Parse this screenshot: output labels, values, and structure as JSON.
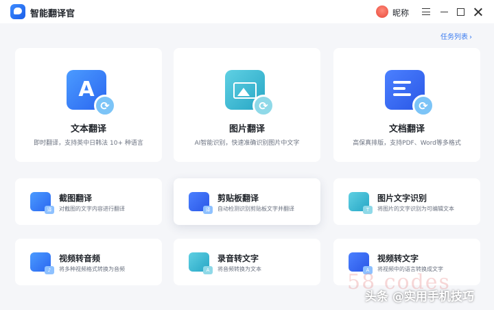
{
  "titlebar": {
    "app_title": "智能翻译官",
    "user_name": "昵称",
    "icons": [
      "app-logo-icon",
      "avatar",
      "menu-icon",
      "minimize-icon",
      "maximize-icon",
      "close-icon"
    ]
  },
  "task_list": {
    "label": "任务列表",
    "chevron": "›"
  },
  "big_cards": [
    {
      "title": "文本翻译",
      "desc": "即时翻译，支持英中日韩法 10+ 种语言",
      "icon": "text-translate-icon"
    },
    {
      "title": "图片翻译",
      "desc": "AI智能识别，快速准确识别图片中文字",
      "icon": "image-translate-icon"
    },
    {
      "title": "文档翻译",
      "desc": "高保真排版，支持PDF、Word等多格式",
      "icon": "document-translate-icon"
    }
  ],
  "small_cards": [
    {
      "title": "截图翻译",
      "desc": "对截图的文字内容进行翻译",
      "icon": "screenshot-icon",
      "badge": "译"
    },
    {
      "title": "剪贴板翻译",
      "desc": "自动检测识别剪贴板文字并翻译",
      "icon": "clipboard-icon",
      "badge": "译"
    },
    {
      "title": "图片文字识别",
      "desc": "将图片的文字识别为可编辑文本",
      "icon": "image-ocr-icon",
      "badge": "T"
    },
    {
      "title": "视频转音频",
      "desc": "将多种视频格式转换为音频",
      "icon": "video-to-audio-icon",
      "badge": "♪"
    },
    {
      "title": "录音转文字",
      "desc": "将音频转换为文本",
      "icon": "audio-to-text-icon",
      "badge": "A"
    },
    {
      "title": "视频转文字",
      "desc": "将视频中的语言转换成文字",
      "icon": "video-to-text-icon",
      "badge": "A"
    }
  ],
  "watermark": {
    "text": "头条 @实用手机技巧",
    "ghost": "58 codes"
  },
  "colors": {
    "accent": "#3a7bf0",
    "background": "#f5f6f9"
  }
}
